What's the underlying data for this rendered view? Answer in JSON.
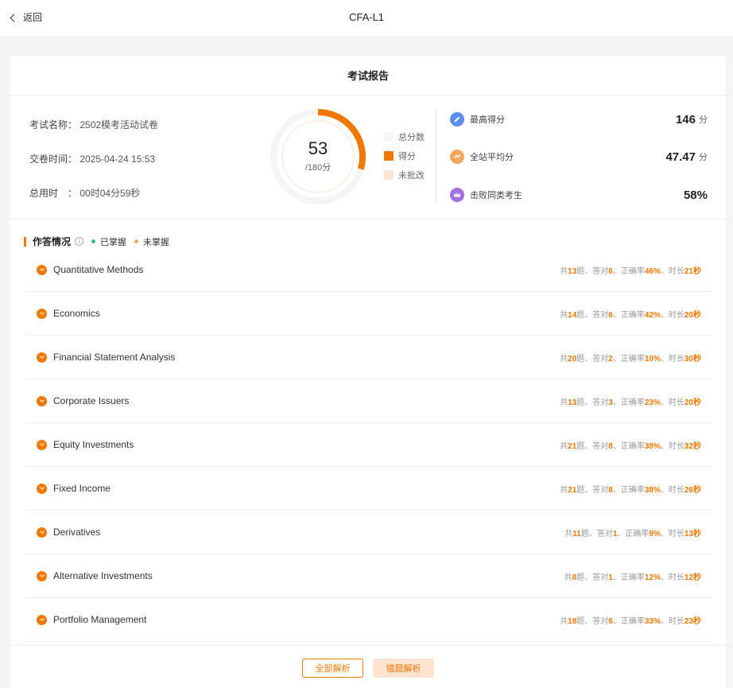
{
  "header": {
    "back_label": "返回",
    "title": "CFA-L1"
  },
  "report": {
    "title": "考试报告",
    "exam_name_label": "考试名称：",
    "exam_name": "2502模考活动试卷",
    "submit_time_label": "交卷时间：",
    "submit_time": "2025-04-24 15:53",
    "duration_label": "总用时　：",
    "duration": "00时04分59秒",
    "score": "53",
    "total": "/180分",
    "legend": {
      "total": "总分数",
      "score": "得分",
      "ungraded": "未批改"
    },
    "colors": {
      "accent": "#f07800",
      "track": "#f5f5f5",
      "ungraded": "#fde4d0"
    }
  },
  "chart_data": {
    "type": "donut",
    "total": 180,
    "segments": [
      {
        "name": "得分",
        "value": 53,
        "color": "#f07800"
      }
    ]
  },
  "stats": [
    {
      "icon": "pencil-icon",
      "label": "最高得分",
      "value": "146",
      "unit": "分",
      "color": "#5a8ff0"
    },
    {
      "icon": "average-icon",
      "label": "全站平均分",
      "value": "47.47",
      "unit": "分",
      "color": "#f4a65c"
    },
    {
      "icon": "crown-icon",
      "label": "击败同类考生",
      "value": "58%",
      "unit": "",
      "color": "#a372e0"
    }
  ],
  "section": {
    "title": "作答情况",
    "mastered": "已掌握",
    "unmastered": "未掌握",
    "mastered_color": "#2bc08a",
    "unmastered_color": "#f4a65c"
  },
  "meta_labels": {
    "total_pre": "共",
    "total_post": "题、",
    "correct_pre": "答对",
    "correct_post": "、",
    "rate_pre": "正确率",
    "rate_post": "、",
    "time_pre": "时长"
  },
  "subjects": [
    {
      "name": "Quantitative Methods",
      "total": "13",
      "correct": "6",
      "rate": "46%",
      "time": "21秒"
    },
    {
      "name": "Economics",
      "total": "14",
      "correct": "6",
      "rate": "42%",
      "time": "20秒"
    },
    {
      "name": "Financial Statement Analysis",
      "total": "20",
      "correct": "2",
      "rate": "10%",
      "time": "30秒"
    },
    {
      "name": "Corporate Issuers",
      "total": "13",
      "correct": "3",
      "rate": "23%",
      "time": "20秒"
    },
    {
      "name": "Equity Investments",
      "total": "21",
      "correct": "8",
      "rate": "38%",
      "time": "32秒"
    },
    {
      "name": "Fixed Income",
      "total": "21",
      "correct": "8",
      "rate": "38%",
      "time": "26秒"
    },
    {
      "name": "Derivatives",
      "total": "11",
      "correct": "1",
      "rate": "9%",
      "time": "13秒"
    },
    {
      "name": "Alternative Investments",
      "total": "8",
      "correct": "1",
      "rate": "12%",
      "time": "12秒"
    },
    {
      "name": "Portfolio Management",
      "total": "18",
      "correct": "6",
      "rate": "33%",
      "time": "23秒"
    }
  ],
  "footer": {
    "all_analysis": "全部解析",
    "wrong_analysis": "错题解析"
  }
}
